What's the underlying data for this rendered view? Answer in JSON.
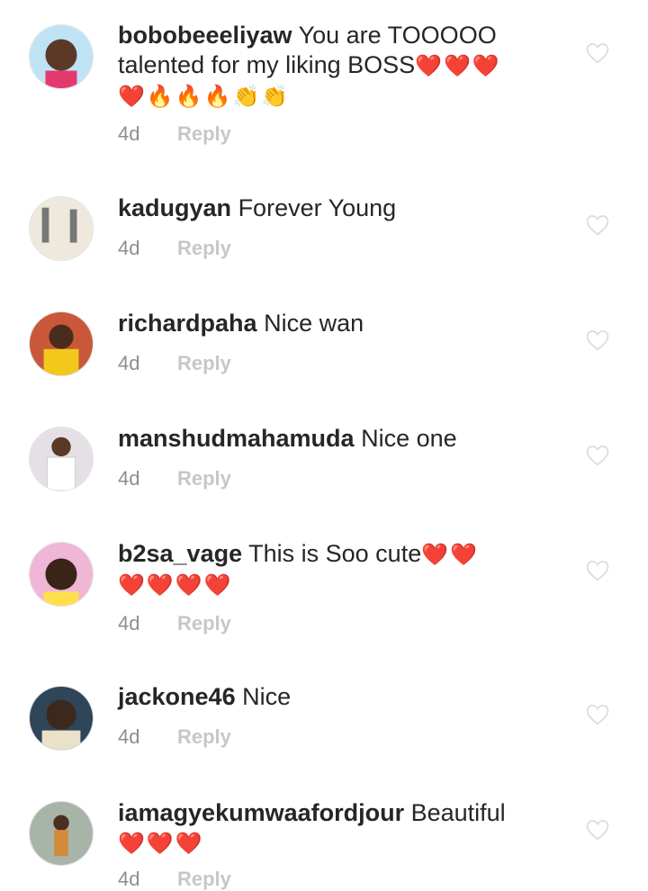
{
  "comments": [
    {
      "username": "bobobeeeliyaw",
      "text_line1": "You are TOOOOO",
      "text_line2": "talented for my liking BOSS",
      "emoji_line2": "❤️❤️❤️",
      "emoji_line3": "❤️🔥🔥🔥👏👏",
      "time": "4d",
      "reply": "Reply",
      "avatar_color": "#c98a5a"
    },
    {
      "username": "kadugyan",
      "text_line1": "Forever Young",
      "time": "4d",
      "reply": "Reply",
      "avatar_color": "#e8e4d8"
    },
    {
      "username": "richardpaha",
      "text_line1": "Nice wan",
      "time": "4d",
      "reply": "Reply",
      "avatar_color": "#d9b23a"
    },
    {
      "username": "manshudmahamuda",
      "text_line1": "Nice one",
      "time": "4d",
      "reply": "Reply",
      "avatar_color": "#dcdcdc"
    },
    {
      "username": "b2sa_vage",
      "text_line1": "This is Soo cute",
      "emoji_line1": "❤️❤️",
      "emoji_line2": "❤️❤️❤️❤️",
      "time": "4d",
      "reply": "Reply",
      "avatar_color": "#e7a8c9"
    },
    {
      "username": "jackone46",
      "text_line1": "Nice",
      "time": "4d",
      "reply": "Reply",
      "avatar_color": "#5d6f7d"
    },
    {
      "username": "iamagyekumwaafordjour",
      "text_line1": "Beautiful",
      "emoji_line2": "❤️❤️❤️",
      "time": "4d",
      "reply": "Reply",
      "avatar_color": "#9aa69a"
    }
  ]
}
